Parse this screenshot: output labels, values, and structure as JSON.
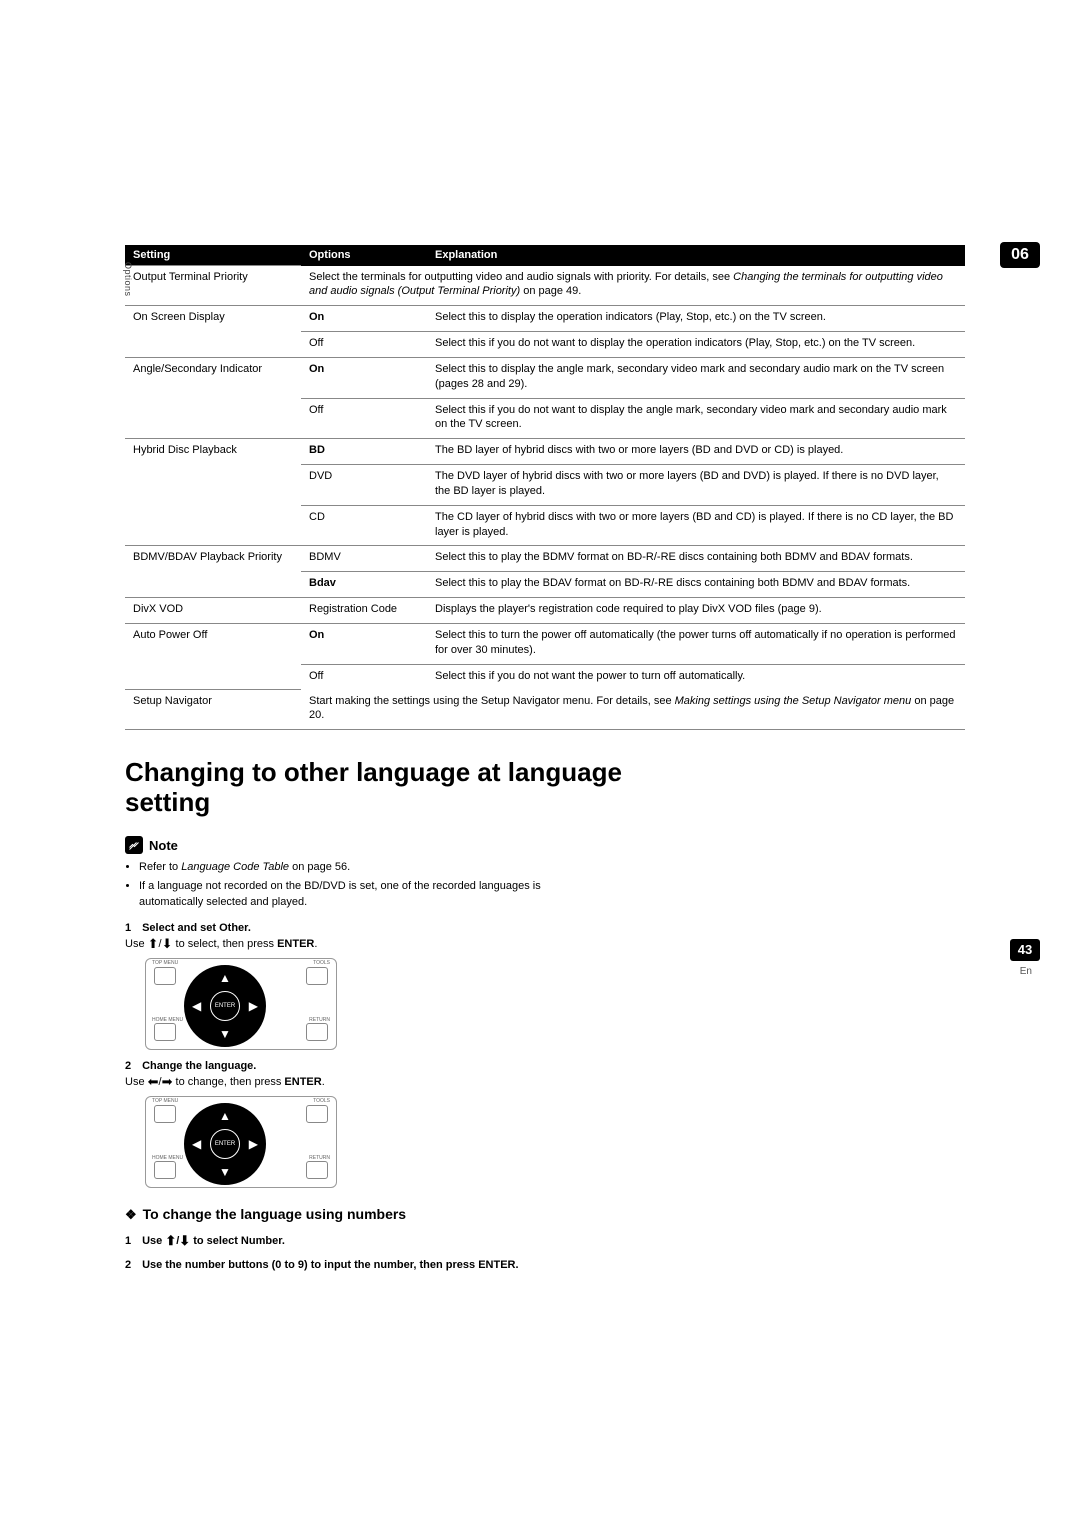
{
  "chapter_number": "06",
  "side_tab": "Options",
  "page_number": "43",
  "page_lang": "En",
  "table": {
    "headers": {
      "setting": "Setting",
      "options": "Options",
      "explanation": "Explanation"
    },
    "rows": [
      {
        "setting": "Output Terminal Priority",
        "option": "",
        "explanation_pre": "Select the terminals for outputting video and audio signals with priority. For details, see ",
        "explanation_italic": "Changing the terminals for outputting video and audio signals (Output Terminal Priority)",
        "explanation_post": " on page 49."
      },
      {
        "setting": "On Screen Display",
        "option": "On",
        "option_bold": true,
        "explanation": "Select this to display the operation indicators (Play, Stop, etc.) on the TV screen."
      },
      {
        "setting": "",
        "option": "Off",
        "explanation": "Select this if you do not want to display the operation indicators (Play, Stop, etc.) on the TV screen."
      },
      {
        "setting": "Angle/Secondary Indicator",
        "option": "On",
        "option_bold": true,
        "explanation": "Select this to display the angle mark, secondary video mark and secondary audio mark on the TV screen (pages 28 and 29)."
      },
      {
        "setting": "",
        "option": "Off",
        "explanation": "Select this if you do not want to display the angle mark, secondary video mark and secondary audio mark on the TV screen."
      },
      {
        "setting": "Hybrid Disc Playback",
        "option": "BD",
        "option_bold": true,
        "explanation": "The BD layer of hybrid discs with two or more layers (BD and DVD or CD) is played."
      },
      {
        "setting": "",
        "option": "DVD",
        "explanation": "The DVD layer of hybrid discs with two or more layers (BD and DVD) is played. If there is no DVD layer, the BD layer is played."
      },
      {
        "setting": "",
        "option": "CD",
        "explanation": "The CD layer of hybrid discs with two or more layers (BD and CD) is played. If there is no CD layer, the BD layer is played."
      },
      {
        "setting": "BDMV/BDAV Playback Priority",
        "option": "BDMV",
        "explanation": "Select this to play the BDMV format on BD-R/-RE discs containing both BDMV and BDAV formats."
      },
      {
        "setting": "",
        "option": "Bdav",
        "option_bold": true,
        "explanation": "Select this to play the BDAV format on BD-R/-RE discs containing both BDMV and BDAV formats."
      },
      {
        "setting": "DivX VOD",
        "option": "Registration Code",
        "explanation": "Displays the player's registration code required to play DivX VOD files (page 9)."
      },
      {
        "setting": "Auto Power Off",
        "option": "On",
        "option_bold": true,
        "explanation": "Select this to turn the power off automatically (the power turns off automatically if no operation is performed for over 30 minutes)."
      },
      {
        "setting": "",
        "option": "Off",
        "explanation": "Select this if you do not want the power to turn off automatically."
      },
      {
        "setting": "Setup Navigator",
        "option": "",
        "explanation_pre": "Start making the settings using the Setup Navigator menu. For details, see ",
        "explanation_italic": "Making settings using the Setup Navigator menu",
        "explanation_post": " on page 20."
      }
    ]
  },
  "section_title": "Changing to other language at language setting",
  "note_label": "Note",
  "bullets": {
    "b1_pre": "Refer to ",
    "b1_italic": "Language Code Table",
    "b1_post": " on page 56.",
    "b2": "If a language not recorded on the BD/DVD is set, one of the recorded languages is automatically selected and played."
  },
  "steps": {
    "s1_num": "1",
    "s1_title": "Select and set Other.",
    "s1_desc_pre": "Use ",
    "s1_desc_mid": " to select, then press ",
    "s1_desc_enter": "ENTER",
    "s1_desc_post": ".",
    "s2_num": "2",
    "s2_title": "Change the language.",
    "s2_desc_pre": "Use ",
    "s2_desc_mid": " to change, then press ",
    "s2_desc_enter": "ENTER",
    "s2_desc_post": "."
  },
  "subhead": "To change the language using numbers",
  "number_steps": {
    "n1_num": "1",
    "n1_pre": "Use ",
    "n1_post": " to select Number.",
    "n2_num": "2",
    "n2_text": "Use the number buttons (0 to 9) to input the number, then press ENTER."
  },
  "remote": {
    "enter": "ENTER",
    "top_menu": "TOP MENU",
    "tools": "TOOLS",
    "home_menu": "HOME MENU",
    "return": "RETURN"
  }
}
